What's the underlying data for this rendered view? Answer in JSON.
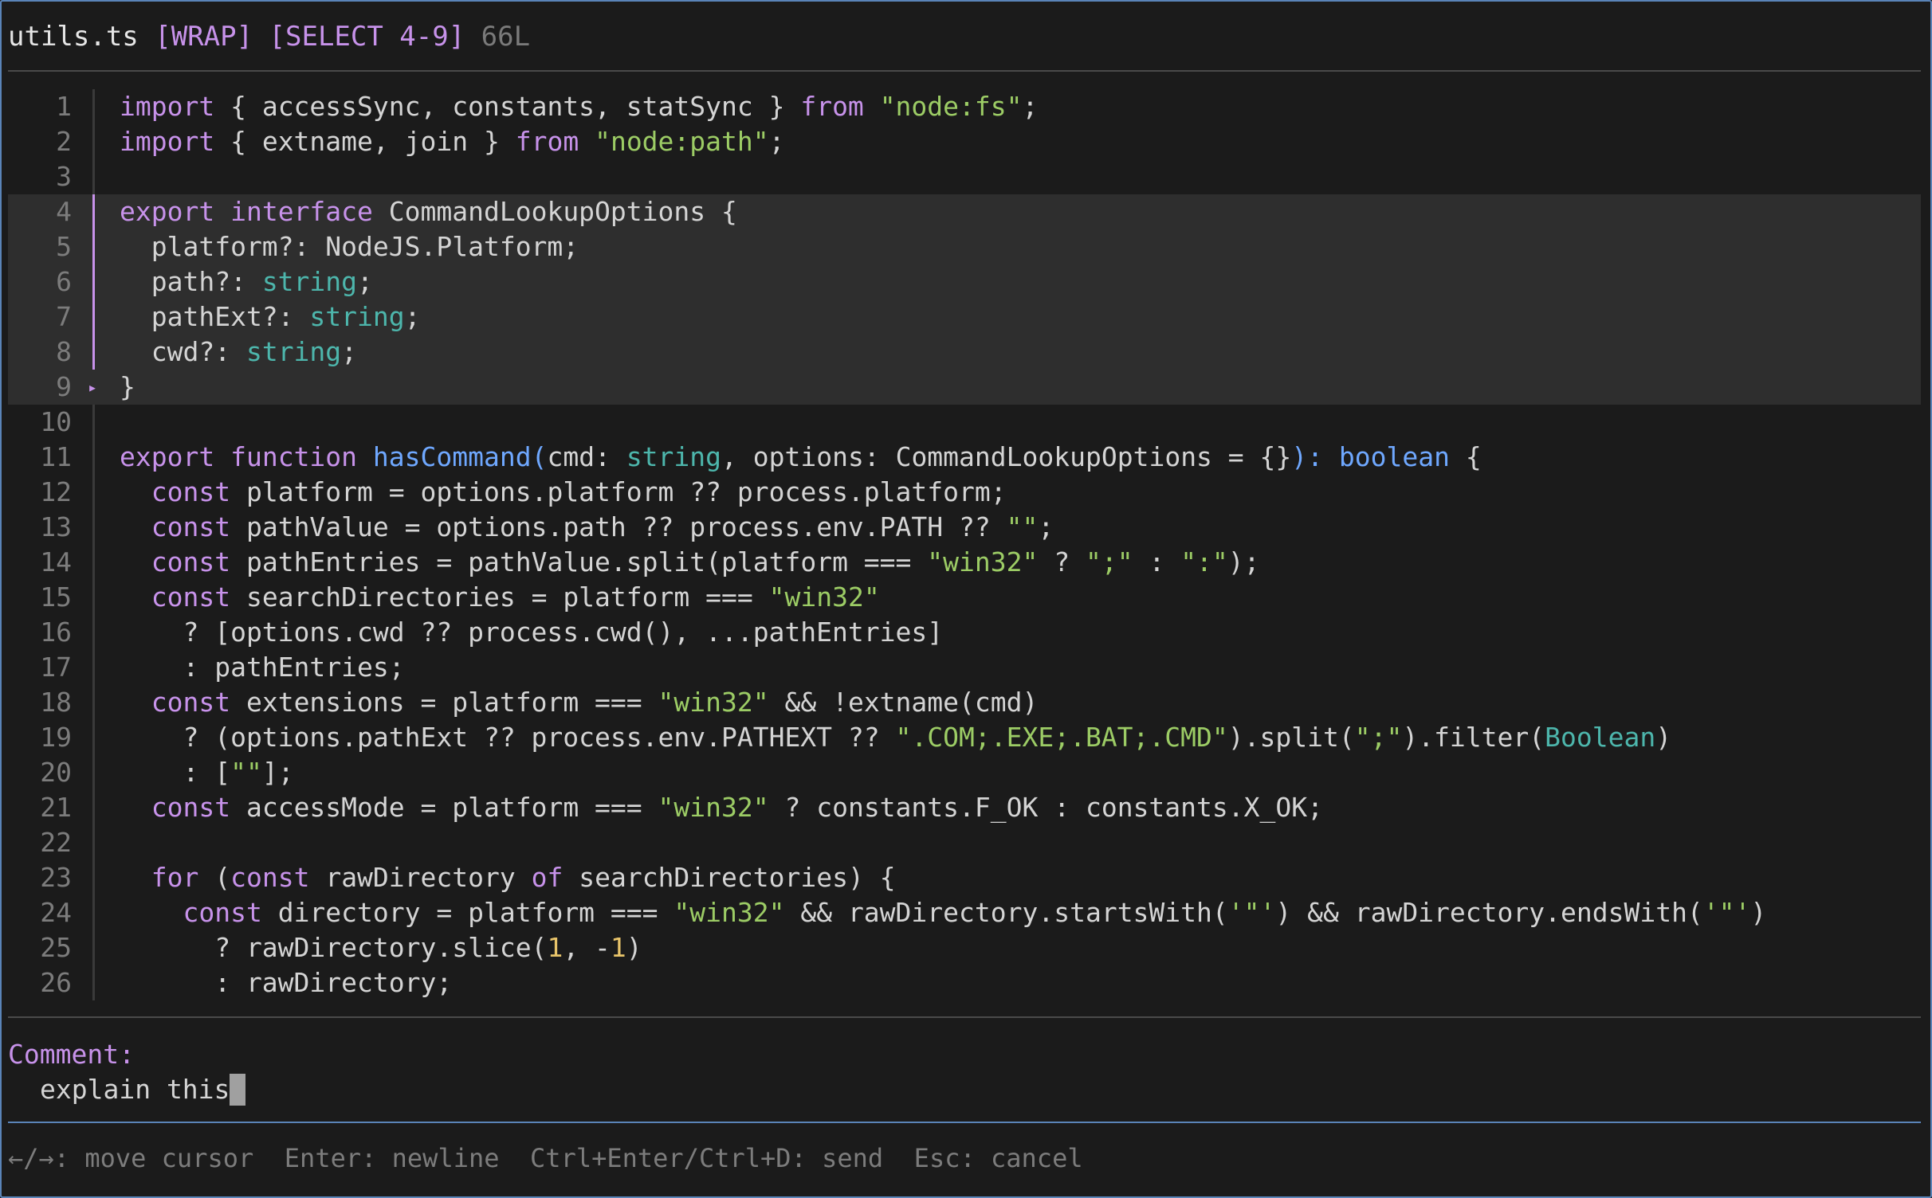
{
  "title": {
    "filename": "utils.ts",
    "flags": "[WRAP] [SELECT 4-9]",
    "line_count": "66L"
  },
  "editor": {
    "selection_range": [
      4,
      9
    ],
    "lines": [
      [
        [
          "kw",
          "import"
        ],
        [
          "pl",
          " { accessSync, constants, statSync } "
        ],
        [
          "kw",
          "from"
        ],
        [
          "pl",
          " "
        ],
        [
          "str",
          "\"node:fs\""
        ],
        [
          "pl",
          ";"
        ]
      ],
      [
        [
          "kw",
          "import"
        ],
        [
          "pl",
          " { extname, join } "
        ],
        [
          "kw",
          "from"
        ],
        [
          "pl",
          " "
        ],
        [
          "str",
          "\"node:path\""
        ],
        [
          "pl",
          ";"
        ]
      ],
      [],
      [
        [
          "kw",
          "export"
        ],
        [
          "pl",
          " "
        ],
        [
          "kw",
          "interface"
        ],
        [
          "pl",
          " CommandLookupOptions {"
        ]
      ],
      [
        [
          "pl",
          "  platform?: NodeJS.Platform;"
        ]
      ],
      [
        [
          "pl",
          "  path?: "
        ],
        [
          "typ",
          "string"
        ],
        [
          "pl",
          ";"
        ]
      ],
      [
        [
          "pl",
          "  pathExt?: "
        ],
        [
          "typ",
          "string"
        ],
        [
          "pl",
          ";"
        ]
      ],
      [
        [
          "pl",
          "  cwd?: "
        ],
        [
          "typ",
          "string"
        ],
        [
          "pl",
          ";"
        ]
      ],
      [
        [
          "pl",
          "}"
        ]
      ],
      [],
      [
        [
          "kw",
          "export"
        ],
        [
          "pl",
          " "
        ],
        [
          "kw",
          "function"
        ],
        [
          "pl",
          " "
        ],
        [
          "fn",
          "hasCommand("
        ],
        [
          "pl",
          "cmd: "
        ],
        [
          "typ",
          "string"
        ],
        [
          "pl",
          ", options: CommandLookupOptions = {}"
        ],
        [
          "fn",
          "): boolean"
        ],
        [
          "pl",
          " {"
        ]
      ],
      [
        [
          "pl",
          "  "
        ],
        [
          "kw",
          "const"
        ],
        [
          "pl",
          " platform = options.platform ?? process.platform;"
        ]
      ],
      [
        [
          "pl",
          "  "
        ],
        [
          "kw",
          "const"
        ],
        [
          "pl",
          " pathValue = options.path ?? process.env.PATH ?? "
        ],
        [
          "str",
          "\"\""
        ],
        [
          "pl",
          ";"
        ]
      ],
      [
        [
          "pl",
          "  "
        ],
        [
          "kw",
          "const"
        ],
        [
          "pl",
          " pathEntries = pathValue.split(platform === "
        ],
        [
          "str",
          "\"win32\""
        ],
        [
          "pl",
          " ? "
        ],
        [
          "str",
          "\";\""
        ],
        [
          "pl",
          " : "
        ],
        [
          "str",
          "\":\""
        ],
        [
          "pl",
          ");"
        ]
      ],
      [
        [
          "pl",
          "  "
        ],
        [
          "kw",
          "const"
        ],
        [
          "pl",
          " searchDirectories = platform === "
        ],
        [
          "str",
          "\"win32\""
        ]
      ],
      [
        [
          "pl",
          "    ? [options.cwd ?? process.cwd(), ...pathEntries]"
        ]
      ],
      [
        [
          "pl",
          "    : pathEntries;"
        ]
      ],
      [
        [
          "pl",
          "  "
        ],
        [
          "kw",
          "const"
        ],
        [
          "pl",
          " extensions = platform === "
        ],
        [
          "str",
          "\"win32\""
        ],
        [
          "pl",
          " && !extname(cmd)"
        ]
      ],
      [
        [
          "pl",
          "    ? (options.pathExt ?? process.env.PATHEXT ?? "
        ],
        [
          "str",
          "\".COM;.EXE;.BAT;.CMD\""
        ],
        [
          "pl",
          ").split("
        ],
        [
          "str",
          "\";\""
        ],
        [
          "pl",
          ").filter("
        ],
        [
          "typ",
          "Boolean"
        ],
        [
          "pl",
          ")"
        ]
      ],
      [
        [
          "pl",
          "    : ["
        ],
        [
          "str",
          "\"\""
        ],
        [
          "pl",
          "];"
        ]
      ],
      [
        [
          "pl",
          "  "
        ],
        [
          "kw",
          "const"
        ],
        [
          "pl",
          " accessMode = platform === "
        ],
        [
          "str",
          "\"win32\""
        ],
        [
          "pl",
          " ? constants.F_OK : constants.X_OK;"
        ]
      ],
      [],
      [
        [
          "pl",
          "  "
        ],
        [
          "kw",
          "for"
        ],
        [
          "pl",
          " ("
        ],
        [
          "kw",
          "const"
        ],
        [
          "pl",
          " rawDirectory "
        ],
        [
          "kw",
          "of"
        ],
        [
          "pl",
          " searchDirectories) {"
        ]
      ],
      [
        [
          "pl",
          "    "
        ],
        [
          "kw",
          "const"
        ],
        [
          "pl",
          " directory = platform === "
        ],
        [
          "str",
          "\"win32\""
        ],
        [
          "pl",
          " && rawDirectory.startsWith("
        ],
        [
          "str",
          "'\"'"
        ],
        [
          "pl",
          ") && rawDirectory.endsWith("
        ],
        [
          "str",
          "'\"'"
        ],
        [
          "pl",
          ")"
        ]
      ],
      [
        [
          "pl",
          "      ? rawDirectory.slice("
        ],
        [
          "num",
          "1"
        ],
        [
          "pl",
          ", -"
        ],
        [
          "num",
          "1"
        ],
        [
          "pl",
          ")"
        ]
      ],
      [
        [
          "pl",
          "      : rawDirectory;"
        ]
      ]
    ]
  },
  "comment": {
    "label": "Comment:",
    "value": "explain this"
  },
  "help": {
    "text": "←/→: move cursor  Enter: newline  Ctrl+Enter/Ctrl+D: send  Esc: cancel"
  }
}
